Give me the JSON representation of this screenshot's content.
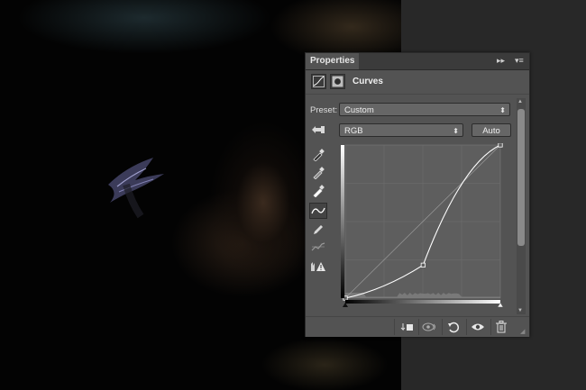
{
  "panel": {
    "tab_label": "Properties",
    "title": "Curves",
    "preset_label": "Preset:",
    "preset_value": "Custom",
    "channel_value": "RGB",
    "auto_label": "Auto"
  },
  "curve_points": [
    {
      "input": 0,
      "output": 0
    },
    {
      "input": 128,
      "output": 55
    },
    {
      "input": 255,
      "output": 255
    }
  ],
  "icons": {
    "panel_menu": "panel-menu-icon",
    "collapse": "double-arrow-icon",
    "adjustment": "curves-adjustment-icon",
    "mask": "layer-mask-icon",
    "tools": [
      "on-image-adjust-icon",
      "sample-shadow-icon",
      "sample-midtone-icon",
      "sample-highlight-icon",
      "curve-point-icon",
      "pencil-icon",
      "smooth-icon",
      "clipping-warning-icon"
    ],
    "bottom": [
      "clip-to-layer-icon",
      "view-previous-icon",
      "reset-icon",
      "visibility-eye-icon",
      "trash-icon"
    ]
  },
  "colors": {
    "panel_bg": "#535353",
    "graph_bg": "#5f5f5f",
    "curve": "#ffffff"
  }
}
